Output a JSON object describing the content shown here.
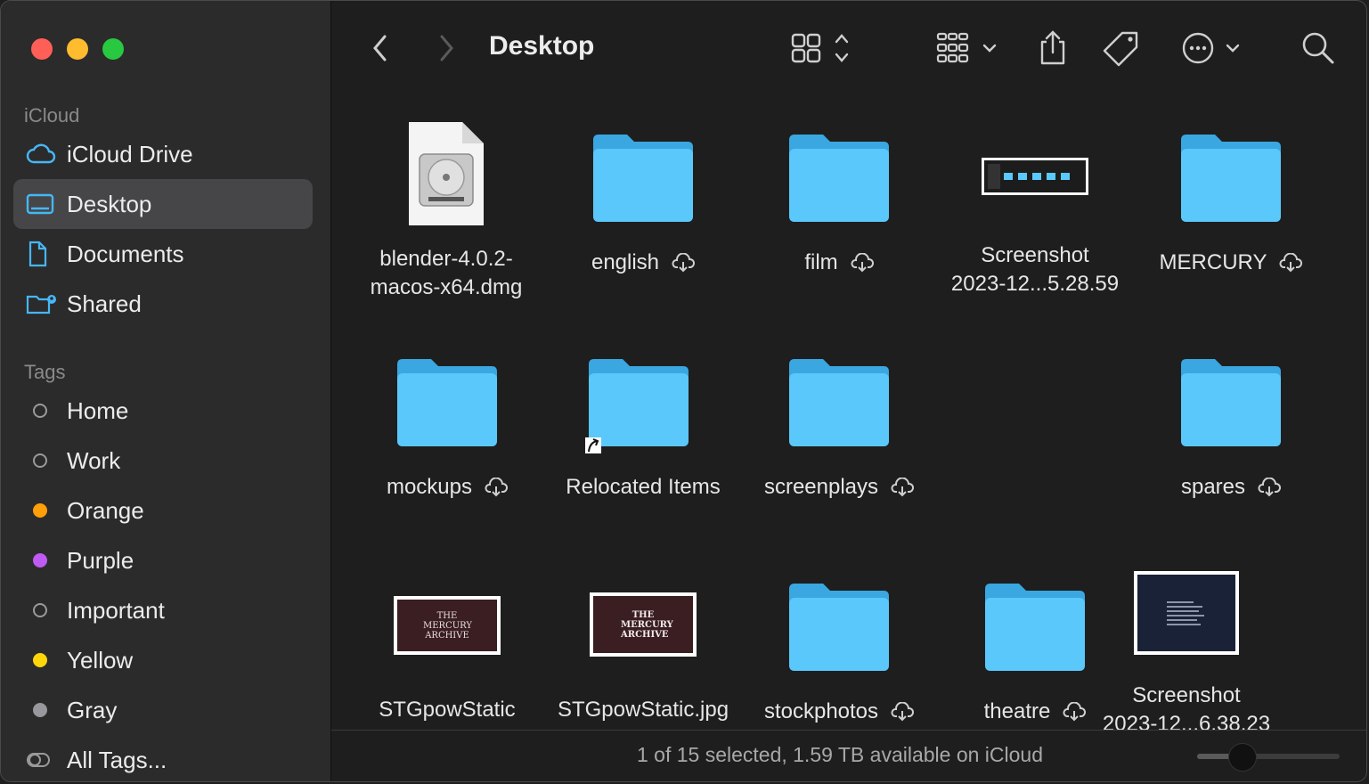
{
  "sidebar": {
    "icloud_header": "iCloud",
    "icloud_items": [
      {
        "label": "iCloud Drive",
        "icon": "cloud-icon"
      },
      {
        "label": "Desktop",
        "icon": "desktop-icon",
        "selected": true
      },
      {
        "label": "Documents",
        "icon": "document-icon"
      },
      {
        "label": "Shared",
        "icon": "shared-folder-icon"
      }
    ],
    "tags_header": "Tags",
    "tags": [
      {
        "label": "Home",
        "color": ""
      },
      {
        "label": "Work",
        "color": ""
      },
      {
        "label": "Orange",
        "color": "#ff9f0a"
      },
      {
        "label": "Purple",
        "color": "#bf5af2"
      },
      {
        "label": "Important",
        "color": ""
      },
      {
        "label": "Yellow",
        "color": "#ffd60a"
      },
      {
        "label": "Gray",
        "color": "#98989d"
      },
      {
        "label": "All Tags...",
        "color": ""
      }
    ]
  },
  "toolbar": {
    "title": "Desktop",
    "back_icon": "chevron-left-icon",
    "forward_icon": "chevron-right-icon",
    "view_icon": "icon-grid-view-icon",
    "group_icon": "group-by-icon",
    "share_icon": "share-icon",
    "tag_icon": "tag-icon",
    "more_icon": "ellipsis-circle-icon",
    "search_icon": "search-icon"
  },
  "files": [
    {
      "line1": "blender-4.0.2-",
      "line2": "macos-x64.dmg",
      "kind": "dmg",
      "cloud": false
    },
    {
      "line1": "english",
      "line2": "",
      "kind": "folder",
      "cloud": true
    },
    {
      "line1": "film",
      "line2": "",
      "kind": "folder",
      "cloud": true
    },
    {
      "line1": "Screenshot",
      "line2": "2023-12...5.28.59",
      "kind": "screenshot",
      "cloud": false
    },
    {
      "line1": "MERCURY",
      "line2": "",
      "kind": "folder",
      "cloud": true
    },
    {
      "line1": "mockups",
      "line2": "",
      "kind": "folder",
      "cloud": true
    },
    {
      "line1": "Relocated Items",
      "line2": "",
      "kind": "alias-folder",
      "cloud": false
    },
    {
      "line1": "screenplays",
      "line2": "",
      "kind": "folder",
      "cloud": true
    },
    {
      "line1": "spares",
      "line2": "",
      "kind": "folder",
      "cloud": true
    },
    {
      "line1": "STGpowStatic",
      "line2": "",
      "kind": "image",
      "cloud": false,
      "thumb_text": "THE MERCURY ARCHIVE"
    },
    {
      "line1": "STGpowStatic.jpg",
      "line2": "",
      "kind": "image",
      "cloud": false,
      "thumb_text": "THE MERCURY ARCHIVE"
    },
    {
      "line1": "stockphotos",
      "line2": "",
      "kind": "folder",
      "cloud": true
    },
    {
      "line1": "theatre",
      "line2": "",
      "kind": "folder",
      "cloud": true
    },
    {
      "line1": "Screenshot",
      "line2": "2023-12...6.38.23",
      "kind": "screenshot-dark",
      "cloud": false
    }
  ],
  "status": {
    "text": "1 of 15 selected, 1.59 TB available on iCloud",
    "icon_size_fraction": 0.27
  },
  "colors": {
    "folder": "#5ac8fa",
    "folder_dark": "#3aa7e0"
  }
}
